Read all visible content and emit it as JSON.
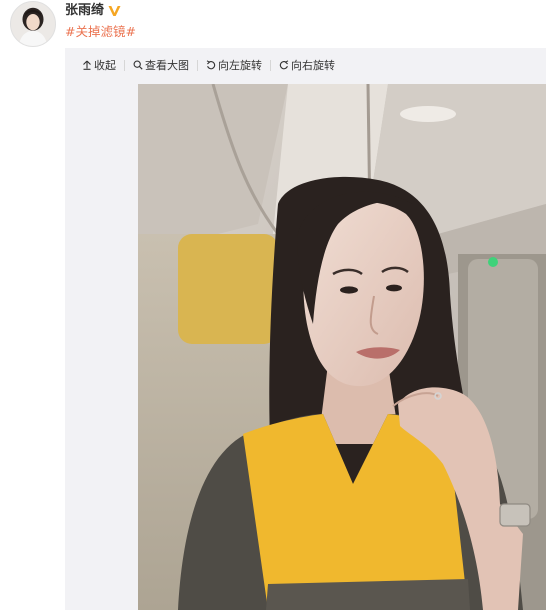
{
  "post": {
    "username": "张雨绮",
    "hashtag": "#关掉滤镜#"
  },
  "toolbar": {
    "collapse_label": "收起",
    "view_large_label": "查看大图",
    "rotate_left_label": "向左旋转",
    "rotate_right_label": "向右旋转"
  },
  "colors": {
    "hashtag": "#eb7350",
    "verified_badge": "#f5a623",
    "panel_bg": "#f2f2f5"
  },
  "icons": {
    "verified": "verified-v-icon",
    "collapse": "arrow-up-icon",
    "view_large": "magnifier-icon",
    "rotate_left": "rotate-left-icon",
    "rotate_right": "rotate-right-icon"
  }
}
